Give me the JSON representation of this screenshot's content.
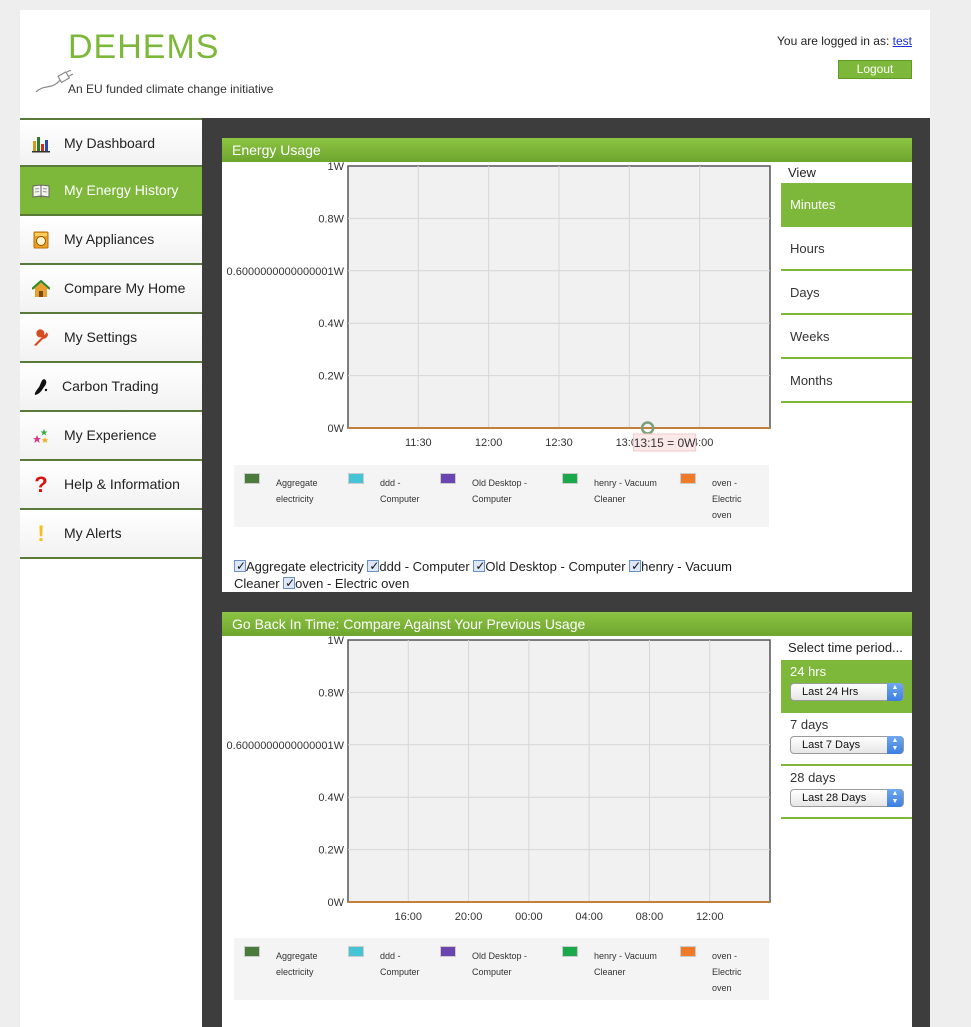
{
  "header": {
    "logo_text": "DEHEMS",
    "tagline": "An EU funded climate change initiative",
    "login_prefix": "You are logged in as:",
    "username": "test",
    "logout_label": "Logout"
  },
  "sidebar": {
    "items": [
      {
        "label": "My Dashboard",
        "icon": "bar-chart-icon"
      },
      {
        "label": "My Energy History",
        "icon": "book-icon"
      },
      {
        "label": "My Appliances",
        "icon": "washing-machine-icon"
      },
      {
        "label": "Compare My Home",
        "icon": "house-icon"
      },
      {
        "label": "My Settings",
        "icon": "wrench-icon"
      },
      {
        "label": "Carbon Trading",
        "icon": "footprint-icon"
      },
      {
        "label": "My Experience",
        "icon": "stars-icon"
      },
      {
        "label": "Help & Information",
        "icon": "question-icon"
      },
      {
        "label": "My Alerts",
        "icon": "exclamation-icon"
      }
    ],
    "active_index": 1
  },
  "energy_usage": {
    "title": "Energy Usage",
    "tooltip": "13:15 = 0W",
    "view": {
      "heading": "View",
      "options": [
        "Minutes",
        "Hours",
        "Days",
        "Weeks",
        "Months"
      ],
      "selected": "Minutes"
    },
    "checkboxes": [
      "Aggregate electricity",
      "ddd - Computer",
      "Old Desktop - Computer",
      "henry - Vacuum Cleaner",
      "oven - Electric oven"
    ]
  },
  "go_back": {
    "title": "Go Back In Time: Compare Against Your Previous Usage",
    "time_period": {
      "heading": "Select time period...",
      "items": [
        {
          "label": "24 hrs",
          "select_value": "Last 24 Hrs"
        },
        {
          "label": "7 days",
          "select_value": "Last 7 Days"
        },
        {
          "label": "28 days",
          "select_value": "Last 28 Days"
        }
      ],
      "active_index": 0
    }
  },
  "legend": [
    {
      "line1": "Aggregate",
      "line2": "electricity",
      "line3": "",
      "color": "#4a7a3c"
    },
    {
      "line1": "ddd -",
      "line2": "Computer",
      "line3": "",
      "color": "#44c4d4"
    },
    {
      "line1": "Old Desktop -",
      "line2": "Computer",
      "line3": "",
      "color": "#6a44b0"
    },
    {
      "line1": "henry - Vacuum",
      "line2": "Cleaner",
      "line3": "",
      "color": "#1aa84a"
    },
    {
      "line1": "oven -",
      "line2": "Electric",
      "line3": "oven",
      "color": "#f07a28"
    }
  ],
  "chart_data": [
    {
      "type": "line",
      "title": "Energy Usage",
      "y_ticks": [
        "0W",
        "0.2W",
        "0.4W",
        "0.6000000000000001W",
        "0.8W",
        "1W"
      ],
      "ylim": [
        0,
        1
      ],
      "x_ticks": [
        "11:30",
        "12:00",
        "12:30",
        "13:00",
        "14:00"
      ],
      "series": [
        {
          "name": "Aggregate electricity",
          "values": [
            0,
            0,
            0,
            0,
            0,
            0,
            0
          ]
        },
        {
          "name": "ddd - Computer",
          "values": [
            0,
            0,
            0,
            0,
            0,
            0,
            0
          ]
        },
        {
          "name": "Old Desktop - Computer",
          "values": [
            0,
            0,
            0,
            0,
            0,
            0,
            0
          ]
        },
        {
          "name": "henry - Vacuum Cleaner",
          "values": [
            0,
            0,
            0,
            0,
            0,
            0,
            0
          ]
        },
        {
          "name": "oven - Electric oven",
          "values": [
            0,
            0,
            0,
            0,
            0,
            0,
            0
          ]
        }
      ],
      "grid": true
    },
    {
      "type": "line",
      "title": "Go Back In Time: Compare Against Your Previous Usage",
      "y_ticks": [
        "0W",
        "0.2W",
        "0.4W",
        "0.6000000000000001W",
        "0.8W",
        "1W"
      ],
      "ylim": [
        0,
        1
      ],
      "x_ticks": [
        "16:00",
        "20:00",
        "00:00",
        "04:00",
        "08:00",
        "12:00"
      ],
      "series": [
        {
          "name": "Aggregate electricity",
          "values": [
            0,
            0,
            0,
            0,
            0,
            0,
            0
          ]
        },
        {
          "name": "ddd - Computer",
          "values": [
            0,
            0,
            0,
            0,
            0,
            0,
            0
          ]
        },
        {
          "name": "Old Desktop - Computer",
          "values": [
            0,
            0,
            0,
            0,
            0,
            0,
            0
          ]
        },
        {
          "name": "henry - Vacuum Cleaner",
          "values": [
            0,
            0,
            0,
            0,
            0,
            0,
            0
          ]
        },
        {
          "name": "oven - Electric oven",
          "values": [
            0,
            0,
            0,
            0,
            0,
            0,
            0
          ]
        }
      ],
      "grid": true
    }
  ]
}
